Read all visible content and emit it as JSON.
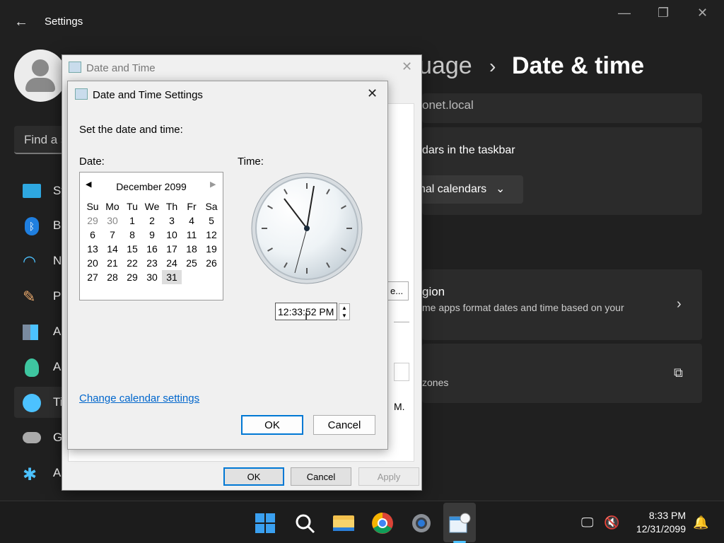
{
  "settings": {
    "title": "Settings",
    "search_placeholder": "Find a s",
    "breadcrumb_parent": "uage",
    "breadcrumb_current": "Date & time",
    "nav": [
      {
        "label": "Sy",
        "icon": "system-icon"
      },
      {
        "label": "Bl",
        "icon": "bluetooth-icon"
      },
      {
        "label": "N",
        "icon": "network-icon"
      },
      {
        "label": "Pe",
        "icon": "personalization-icon"
      },
      {
        "label": "A",
        "icon": "apps-icon"
      },
      {
        "label": "A",
        "icon": "accounts-icon"
      },
      {
        "label": "Ti",
        "icon": "time-language-icon"
      },
      {
        "label": "G",
        "icon": "gaming-icon"
      },
      {
        "label": "A",
        "icon": "accessibility-icon"
      }
    ],
    "card1_text": "onet.local",
    "card2_text": "dars in the taskbar",
    "card2_button": "nal calendars",
    "card3_title": "gion",
    "card3_desc": "me apps format dates and time based on your",
    "card4_desc": "zones"
  },
  "outer_dialog": {
    "title": "Date and Time",
    "frag_button": "e...",
    "frag_text": "M.",
    "ok": "OK",
    "cancel": "Cancel",
    "apply": "Apply"
  },
  "inner_dialog": {
    "title": "Date and Time Settings",
    "prompt": "Set the date and time:",
    "date_label": "Date:",
    "time_label": "Time:",
    "calendar": {
      "month": "December 2099",
      "weekdays": [
        "Su",
        "Mo",
        "Tu",
        "We",
        "Th",
        "Fr",
        "Sa"
      ],
      "days": [
        [
          "29",
          "30",
          "1",
          "2",
          "3",
          "4",
          "5"
        ],
        [
          "6",
          "7",
          "8",
          "9",
          "10",
          "11",
          "12"
        ],
        [
          "13",
          "14",
          "15",
          "16",
          "17",
          "18",
          "19"
        ],
        [
          "20",
          "21",
          "22",
          "23",
          "24",
          "25",
          "26"
        ],
        [
          "27",
          "28",
          "29",
          "30",
          "31",
          "",
          ""
        ]
      ],
      "selected": "31"
    },
    "time_value": "12:33:52 PM",
    "link": "Change calendar settings",
    "ok": "OK",
    "cancel": "Cancel"
  },
  "taskbar": {
    "time": "8:33 PM",
    "date": "12/31/2099",
    "apps": [
      "start-icon",
      "search-icon",
      "file-explorer-icon",
      "chrome-icon",
      "settings-app-icon",
      "date-time-app-icon"
    ]
  }
}
